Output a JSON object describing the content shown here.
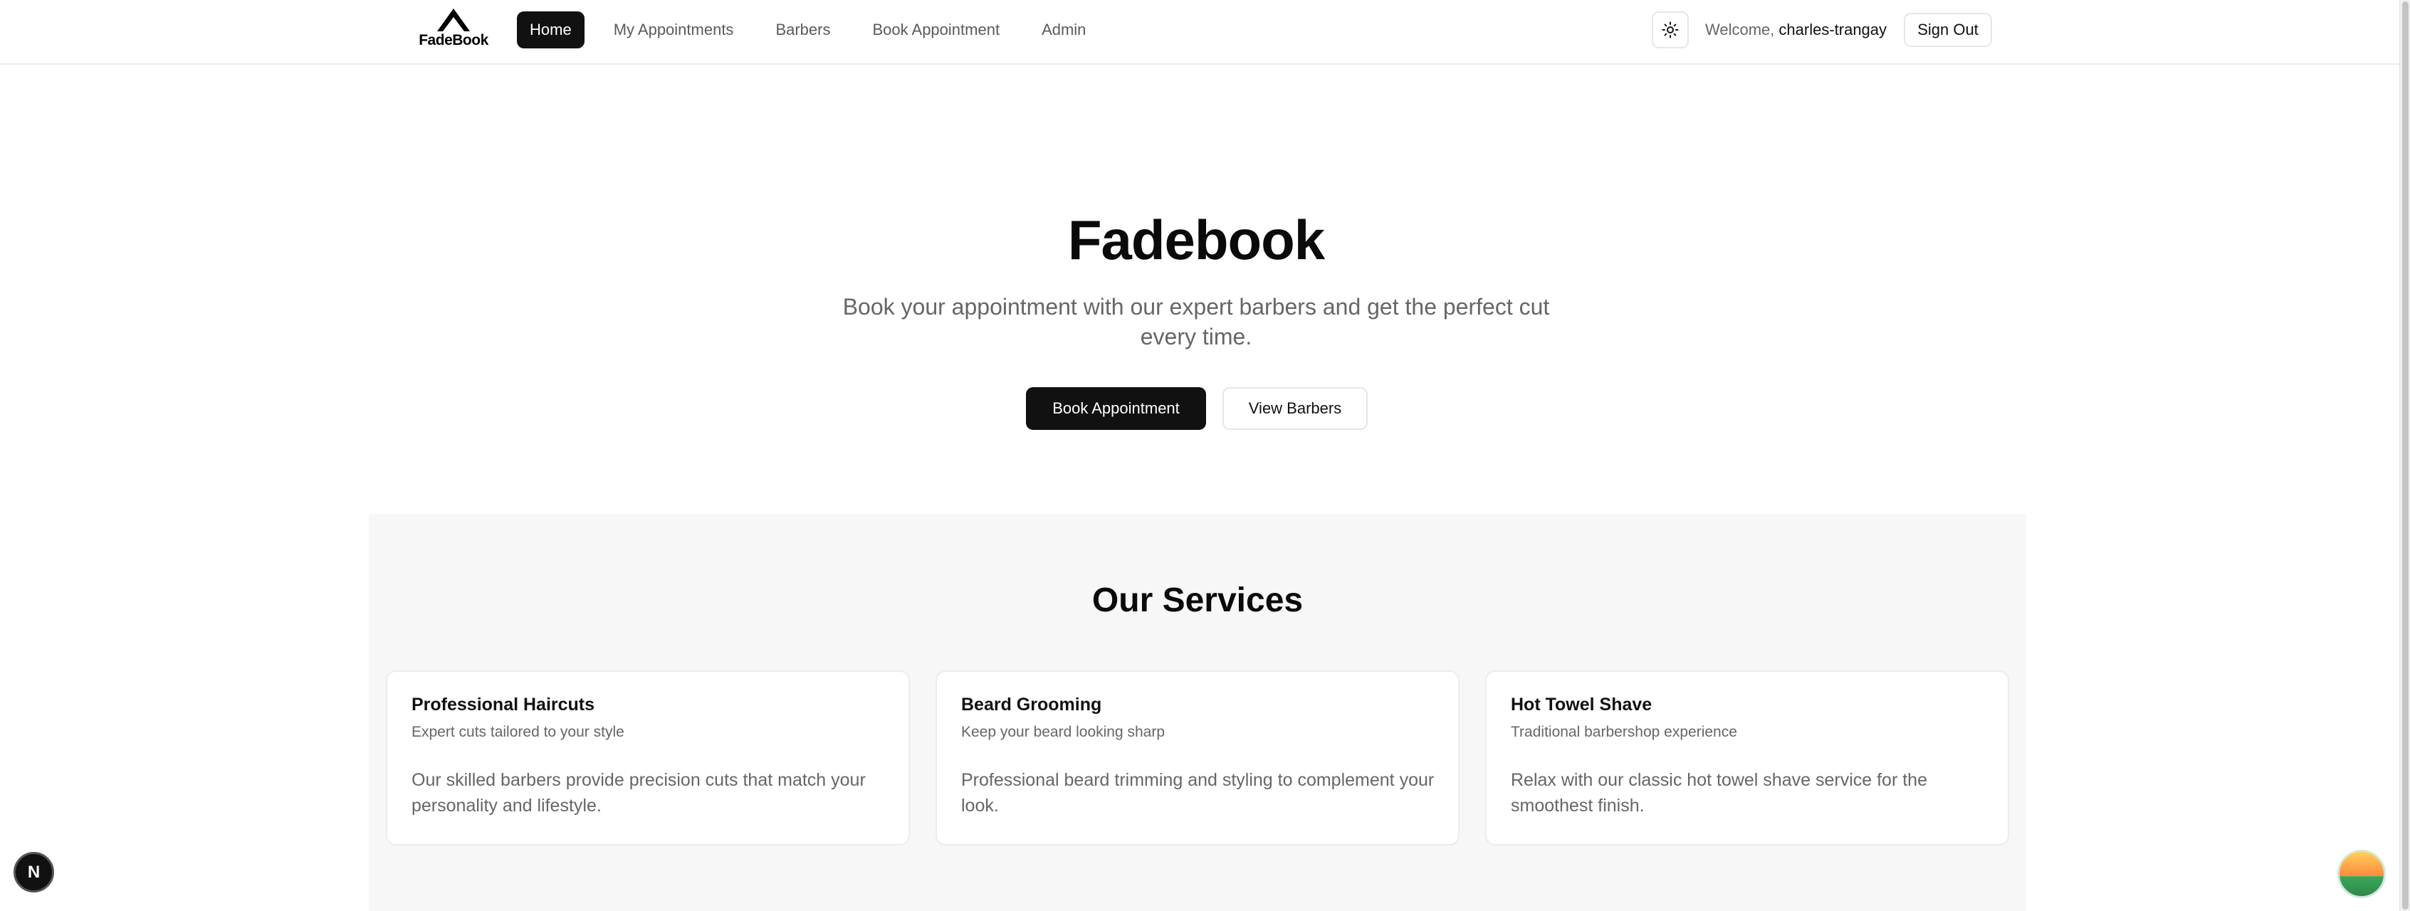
{
  "header": {
    "logo_text": "FadeBook",
    "nav": [
      {
        "label": "Home",
        "active": true
      },
      {
        "label": "My Appointments",
        "active": false
      },
      {
        "label": "Barbers",
        "active": false
      },
      {
        "label": "Book Appointment",
        "active": false
      },
      {
        "label": "Admin",
        "active": false
      }
    ],
    "theme_icon": "sun-icon",
    "welcome_label": "Welcome,",
    "username": "charles-trangay",
    "signout_label": "Sign Out"
  },
  "hero": {
    "title": "Fadebook",
    "subtitle": "Book your appointment with our expert barbers and get the perfect cut every time.",
    "primary_button": "Book Appointment",
    "secondary_button": "View Barbers"
  },
  "services": {
    "title": "Our Services",
    "cards": [
      {
        "title": "Professional Haircuts",
        "subtitle": "Expert cuts tailored to your style",
        "description": "Our skilled barbers provide precision cuts that match your personality and lifestyle."
      },
      {
        "title": "Beard Grooming",
        "subtitle": "Keep your beard looking sharp",
        "description": "Professional beard trimming and styling to complement your look."
      },
      {
        "title": "Hot Towel Shave",
        "subtitle": "Traditional barbershop experience",
        "description": "Relax with our classic hot towel shave service for the smoothest finish."
      }
    ]
  },
  "floating": {
    "dev_badge_letter": "N",
    "dev_badge_icon": "nextjs-icon",
    "widget_icon": "landscape-widget-icon"
  },
  "colors": {
    "primary": "#111111",
    "muted_text": "#666666",
    "section_bg": "#f7f7f7",
    "border": "#e6e6e6"
  }
}
